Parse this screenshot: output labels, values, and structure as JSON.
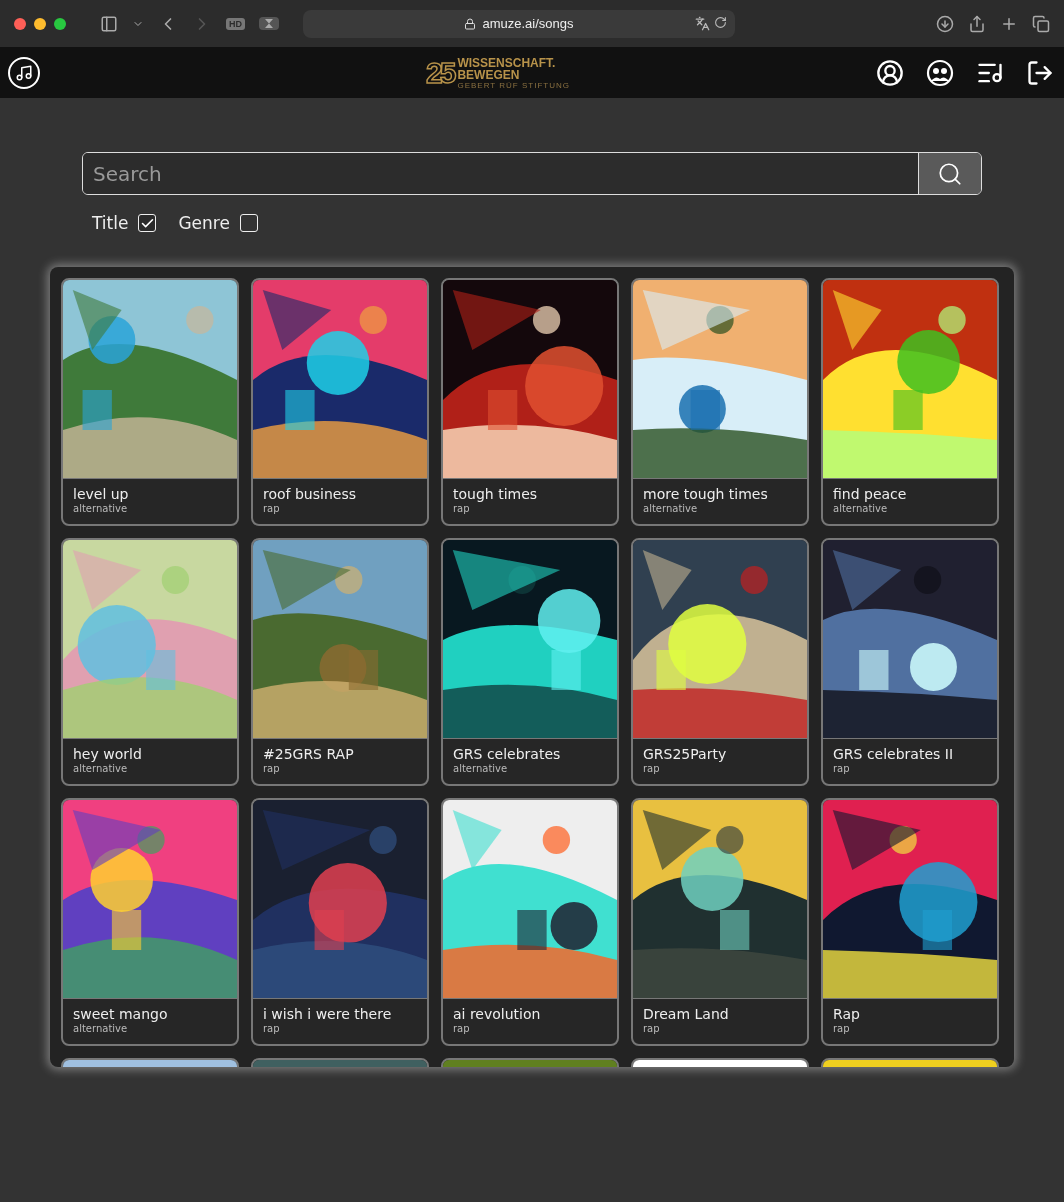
{
  "browser": {
    "url": "amuze.ai/songs",
    "badge": "HD"
  },
  "header": {
    "logo": {
      "mark": "25",
      "line_1": "WISSENSCHAFT.",
      "line_2": "BEWEGEN",
      "line_3": "GEBERT RÜF STIFTUNG"
    }
  },
  "search": {
    "placeholder": "Search"
  },
  "filters": [
    {
      "label": "Title",
      "checked": true
    },
    {
      "label": "Genre",
      "checked": false
    }
  ],
  "songs": [
    {
      "kind": "song",
      "title": "level up",
      "genre": "alternative"
    },
    {
      "kind": "song",
      "title": "roof business",
      "genre": "rap"
    },
    {
      "kind": "song",
      "title": "tough times",
      "genre": "rap"
    },
    {
      "kind": "song",
      "title": "more tough times",
      "genre": "alternative"
    },
    {
      "kind": "song",
      "title": "find peace",
      "genre": "alternative"
    },
    {
      "kind": "song",
      "title": "hey world",
      "genre": "alternative"
    },
    {
      "kind": "song",
      "title": "#25GRS RAP",
      "genre": "rap"
    },
    {
      "kind": "song",
      "title": "GRS celebrates",
      "genre": "alternative"
    },
    {
      "kind": "song",
      "title": "GRS25Party",
      "genre": "rap"
    },
    {
      "kind": "song",
      "title": "GRS celebrates II",
      "genre": "rap"
    },
    {
      "kind": "song",
      "title": "sweet mango",
      "genre": "alternative"
    },
    {
      "kind": "song",
      "title": "i wish i were there",
      "genre": "rap"
    },
    {
      "kind": "song",
      "title": "ai revolution",
      "genre": "rap"
    },
    {
      "kind": "song",
      "title": "Dream Land",
      "genre": "rap"
    },
    {
      "kind": "song",
      "title": "Rap",
      "genre": "rap"
    },
    {
      "kind": "picture"
    },
    {
      "kind": "picture"
    },
    {
      "kind": "picture"
    },
    {
      "kind": "picture"
    },
    {
      "kind": "picture"
    }
  ]
}
